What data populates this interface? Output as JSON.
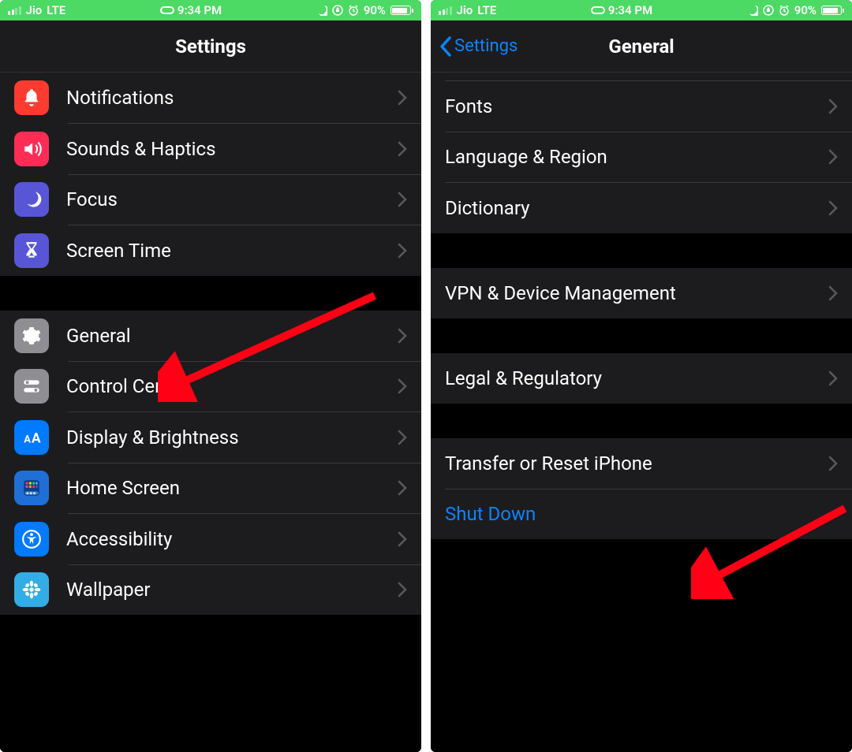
{
  "status": {
    "carrier": "Jio",
    "network": "LTE",
    "time": "9:34 PM",
    "battery_pct": "90%"
  },
  "left": {
    "title": "Settings",
    "groupA": [
      {
        "label": "Notifications",
        "name": "settings-notifications"
      },
      {
        "label": "Sounds & Haptics",
        "name": "settings-sounds-haptics"
      },
      {
        "label": "Focus",
        "name": "settings-focus"
      },
      {
        "label": "Screen Time",
        "name": "settings-screen-time"
      }
    ],
    "groupB": [
      {
        "label": "General",
        "name": "settings-general"
      },
      {
        "label": "Control Centre",
        "name": "settings-control-centre"
      },
      {
        "label": "Display & Brightness",
        "name": "settings-display-brightness"
      },
      {
        "label": "Home Screen",
        "name": "settings-home-screen"
      },
      {
        "label": "Accessibility",
        "name": "settings-accessibility"
      },
      {
        "label": "Wallpaper",
        "name": "settings-wallpaper"
      }
    ]
  },
  "right": {
    "back": "Settings",
    "title": "General",
    "groupA": [
      {
        "label": "Fonts",
        "name": "general-fonts"
      },
      {
        "label": "Language & Region",
        "name": "general-language-region"
      },
      {
        "label": "Dictionary",
        "name": "general-dictionary"
      }
    ],
    "groupB": [
      {
        "label": "VPN & Device Management",
        "name": "general-vpn-device-mgmt"
      }
    ],
    "groupC": [
      {
        "label": "Legal & Regulatory",
        "name": "general-legal-regulatory"
      }
    ],
    "groupD": [
      {
        "label": "Transfer or Reset iPhone",
        "name": "general-transfer-reset",
        "chevron": true
      },
      {
        "label": "Shut Down",
        "name": "general-shut-down",
        "link": true
      }
    ]
  }
}
